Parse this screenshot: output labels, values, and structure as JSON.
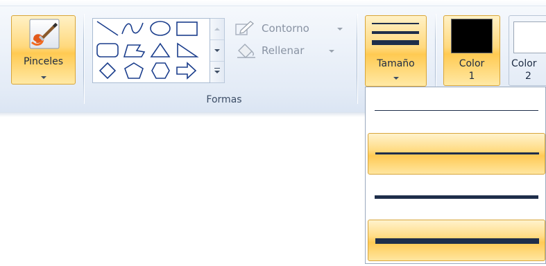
{
  "ribbon": {
    "brushes_label": "Pinceles",
    "shapes_group_label": "Formas",
    "outline_label": "Contorno",
    "fill_label": "Rellenar",
    "size_label": "Tamaño",
    "color1": {
      "label_line1": "Color",
      "label_line2": "1",
      "value": "#000000"
    },
    "color2": {
      "label_line1": "Color",
      "label_line2": "2",
      "value": "#ffffff"
    },
    "shapes": [
      "line-shape",
      "curve-shape",
      "oval-shape",
      "rectangle-shape",
      "rounded-rectangle-shape",
      "polygon-shape",
      "triangle-shape",
      "right-triangle-shape",
      "diamond-shape",
      "pentagon-shape",
      "hexagon-shape",
      "right-arrow-shape"
    ]
  },
  "size_dropdown": {
    "options": [
      {
        "name": "size-1px",
        "selected": false
      },
      {
        "name": "size-3px",
        "selected": true
      },
      {
        "name": "size-5px",
        "selected": false
      },
      {
        "name": "size-8px",
        "selected": true
      }
    ]
  },
  "colors": {
    "highlight": "#ffd97e",
    "highlight_border": "#d9a537",
    "ribbon_bg": "#eef3fa",
    "line_color": "#1e2e4a"
  }
}
